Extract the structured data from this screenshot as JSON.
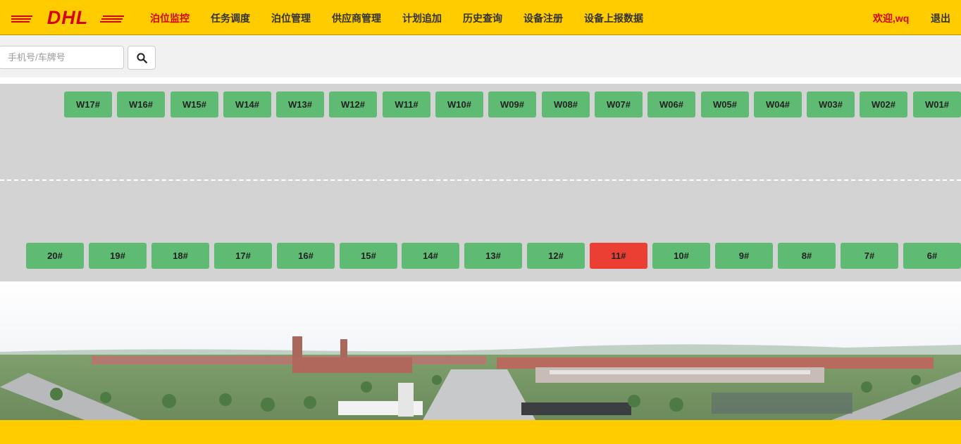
{
  "brand": {
    "logo_text": "DHL",
    "primary_color": "#ffcc00",
    "accent_color": "#d40511"
  },
  "nav": {
    "items": [
      {
        "label": "泊位监控",
        "active": true
      },
      {
        "label": "任务调度"
      },
      {
        "label": "泊位管理"
      },
      {
        "label": "供应商管理"
      },
      {
        "label": "计划追加"
      },
      {
        "label": "历史查询"
      },
      {
        "label": "设备注册"
      },
      {
        "label": "设备上报数据"
      }
    ],
    "welcome": "欢迎,wq",
    "logout": "退出"
  },
  "search": {
    "placeholder": "手机号/车牌号",
    "value": "",
    "button_icon": "search-icon"
  },
  "yard": {
    "status_colors": {
      "free": "#5fbb73",
      "occupied": "#ea3f32"
    },
    "top_docks": [
      {
        "label": "W17#",
        "status": "free"
      },
      {
        "label": "W16#",
        "status": "free"
      },
      {
        "label": "W15#",
        "status": "free"
      },
      {
        "label": "W14#",
        "status": "free"
      },
      {
        "label": "W13#",
        "status": "free"
      },
      {
        "label": "W12#",
        "status": "free"
      },
      {
        "label": "W11#",
        "status": "free"
      },
      {
        "label": "W10#",
        "status": "free"
      },
      {
        "label": "W09#",
        "status": "free"
      },
      {
        "label": "W08#",
        "status": "free"
      },
      {
        "label": "W07#",
        "status": "free"
      },
      {
        "label": "W06#",
        "status": "free"
      },
      {
        "label": "W05#",
        "status": "free"
      },
      {
        "label": "W04#",
        "status": "free"
      },
      {
        "label": "W03#",
        "status": "free"
      },
      {
        "label": "W02#",
        "status": "free"
      },
      {
        "label": "W01#",
        "status": "free"
      }
    ],
    "bottom_docks": [
      {
        "label": "20#",
        "status": "free"
      },
      {
        "label": "19#",
        "status": "free"
      },
      {
        "label": "18#",
        "status": "free"
      },
      {
        "label": "17#",
        "status": "free"
      },
      {
        "label": "16#",
        "status": "free"
      },
      {
        "label": "15#",
        "status": "free"
      },
      {
        "label": "14#",
        "status": "free"
      },
      {
        "label": "13#",
        "status": "free"
      },
      {
        "label": "12#",
        "status": "free"
      },
      {
        "label": "11#",
        "status": "occupied"
      },
      {
        "label": "10#",
        "status": "free"
      },
      {
        "label": "9#",
        "status": "free"
      },
      {
        "label": "8#",
        "status": "free"
      },
      {
        "label": "7#",
        "status": "free"
      },
      {
        "label": "6#",
        "status": "free"
      }
    ]
  }
}
